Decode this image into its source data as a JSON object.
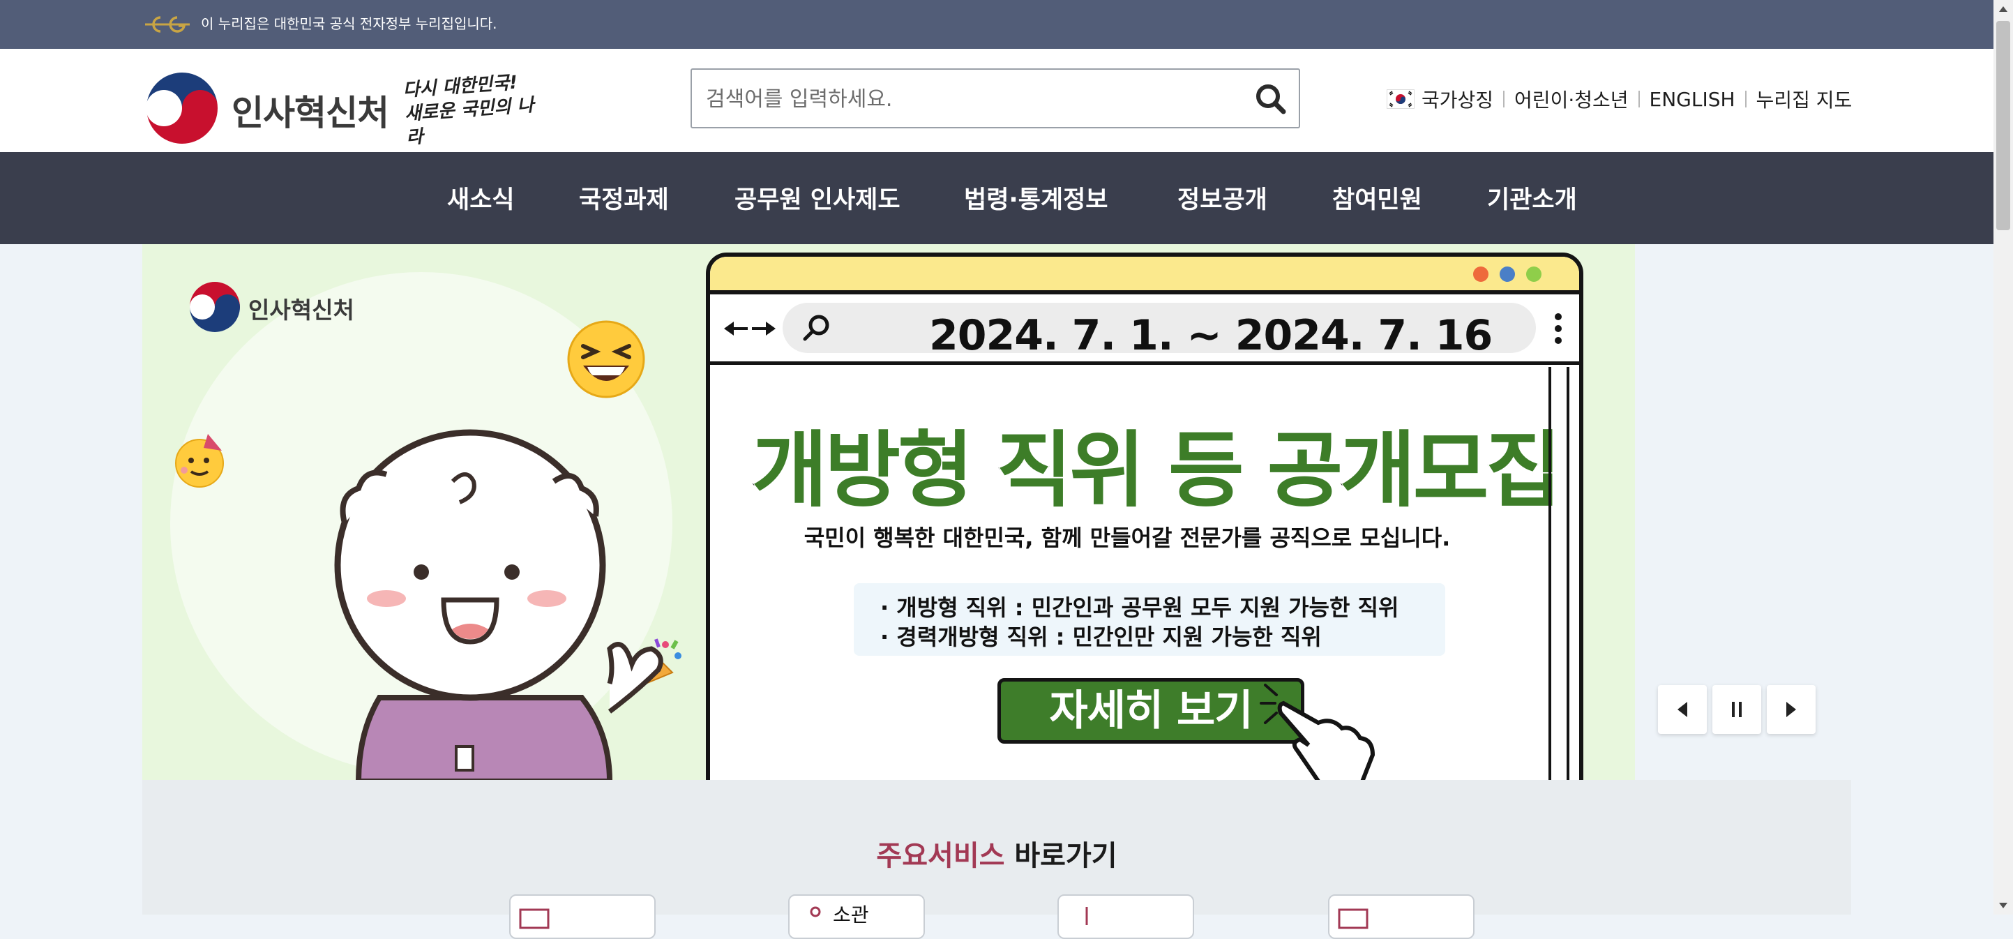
{
  "gov_banner": {
    "text": "이 누리집은 대한민국 공식 전자정부 누리집입니다."
  },
  "header": {
    "logo_text": "인사혁신처",
    "slogan": "다시 대한민국! 새로운 국민의 나라",
    "search": {
      "placeholder": "검색어를 입력하세요.",
      "value": ""
    },
    "util_links": [
      "국가상징",
      "어린이·청소년",
      "ENGLISH",
      "누리집 지도"
    ]
  },
  "gnb": {
    "items": [
      "새소식",
      "국정과제",
      "공무원 인사제도",
      "법령·통계정보",
      "정보공개",
      "참여민원",
      "기관소개"
    ]
  },
  "hero": {
    "logo_text": "인사혁신처",
    "date_range": "2024. 7. 1. ~ 2024. 7. 16",
    "headline": "개방형 직위 등  공개모집",
    "subline": "국민이 행복한 대한민국, 함께 만들어갈 전문가를 공직으로 모십니다.",
    "info_lines": [
      "· 개방형 직위 : 민간인과 공무원 모두 지원 가능한 직위",
      "· 경력개방형 직위 : 민간인만 지원 가능한 직위"
    ],
    "cta_label": "자세히 보기"
  },
  "services": {
    "title_accent": "주요서비스",
    "title_rest": " 바로가기",
    "visible_card_label": "소관"
  },
  "colors": {
    "banner": "#525d78",
    "gnb": "#3a3e4d",
    "hero_bg": "#e8f7dd",
    "accent_green": "#3d7d28",
    "accent_red": "#a23954",
    "browser_top": "#fbe98d"
  }
}
